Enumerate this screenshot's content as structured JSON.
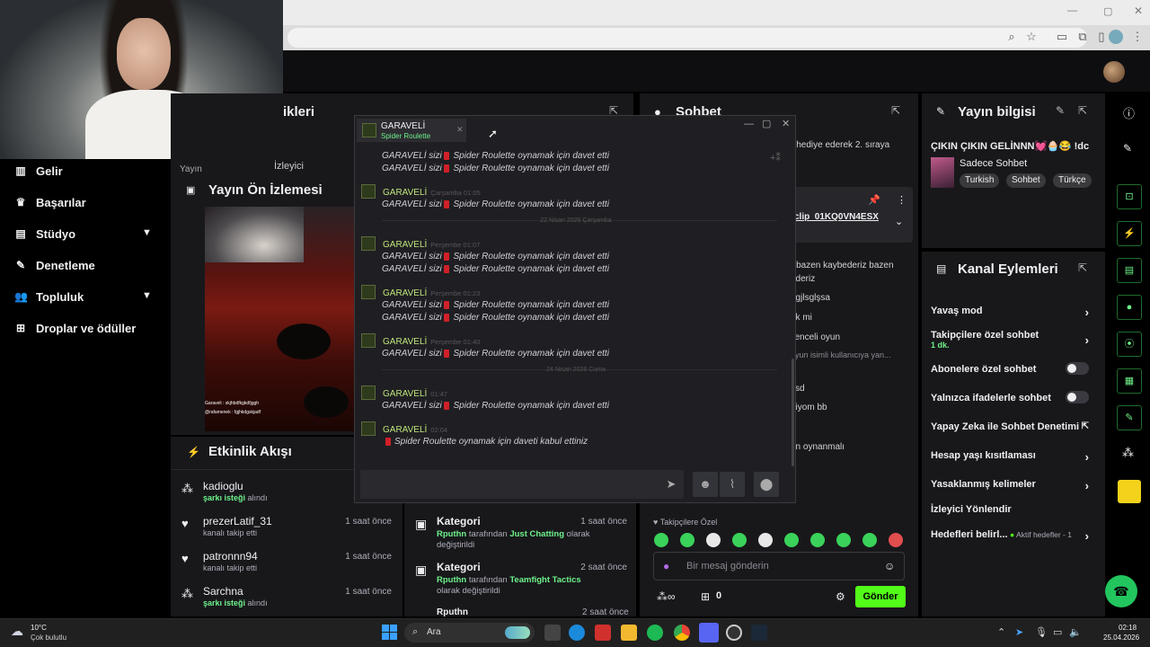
{
  "left_nav": [
    {
      "icon": "bar-chart-icon",
      "label": "Gelir"
    },
    {
      "icon": "trophy-icon",
      "label": "Başarılar"
    },
    {
      "icon": "film-icon",
      "label": "Stüdyo",
      "chevron": true
    },
    {
      "icon": "wrench-icon",
      "label": "Denetleme"
    },
    {
      "icon": "users-icon",
      "label": "Topluluk",
      "chevron": true
    },
    {
      "icon": "gift-icon",
      "label": "Droplar ve ödüller"
    }
  ],
  "stats_panel": {
    "title_fragment": "ikleri",
    "col1": "Yayın",
    "col2": "İzleyici"
  },
  "preview": {
    "title": "Yayın Ön İzlemesi",
    "overlay_chat": [
      "Garaveli : skjhbdfkgkdfjggh",
      "@rafamenek : fgjhkdgskjadf"
    ]
  },
  "events": {
    "title": "Etkinlik Akışı",
    "items": [
      {
        "icon": "points-icon",
        "name": "kadioglu",
        "highlight": "şarkı isteği",
        "suffix": "alındı",
        "time": "1"
      },
      {
        "icon": "heart-icon",
        "name": "prezerLatif_31",
        "sub": "kanalı takip etti",
        "time": "1 saat önce"
      },
      {
        "icon": "heart-icon",
        "name": "patronnn94",
        "sub": "kanalı takip etti",
        "time": "1 saat önce"
      },
      {
        "icon": "points-icon",
        "name": "Sarchna",
        "highlight": "şarkı isteği",
        "suffix": "alındı",
        "time": "1 saat önce"
      }
    ]
  },
  "activity": {
    "items": [
      {
        "title": "Kategori",
        "time": "1 saat önce",
        "user": "Rputhn",
        "mid": "tarafından",
        "category": "Just Chatting",
        "end": "olarak değiştirildi"
      },
      {
        "title": "Kategori",
        "time": "2 saat önce",
        "user": "Rputhn",
        "mid": "tarafından",
        "category": "Teamfight Tactics",
        "end": "olarak değiştirildi"
      }
    ],
    "partial": "Rputhn",
    "partial_time": "2 saat önce"
  },
  "chat": {
    "title": "Sohbet",
    "top_text": "lik hediye ederek 2. sıraya",
    "pinned_link": "clip_01KQ0VN4ESX",
    "lines": [
      "r bazen kaybederiz bazen",
      "ederiz",
      "agjlsglşsa",
      "ek mi",
      "ilenceli oyun",
      "oyun isimli kullanıcıya yan...",
      "şsd",
      "diyom bb",
      "ün oynanmalı"
    ],
    "followers_only": "Takipçilere Özel",
    "input_placeholder": "Bir mesaj gönderin",
    "points": "0",
    "send_label": "Gönder"
  },
  "stream_info": {
    "title": "Yayın bilgisi",
    "stream_title": "ÇIKIN ÇIKIN GELİNNN💓🧁😂 !dc",
    "category": "Sadece Sohbet",
    "tags": [
      "Turkish",
      "Sohbet",
      "Türkçe"
    ]
  },
  "channel_actions": {
    "title": "Kanal Eylemleri",
    "rows": [
      {
        "label": "Yavaş mod",
        "control": "chevron"
      },
      {
        "label": "Takipçilere özel sohbet",
        "sub": "1 dk.",
        "control": "chevron"
      },
      {
        "label": "Abonelere özel sohbet",
        "control": "toggle"
      },
      {
        "label": "Yalnızca ifadelerle sohbet",
        "control": "toggle"
      },
      {
        "label": "Yapay Zeka ile Sohbet Denetimi",
        "control": "external"
      },
      {
        "label": "Hesap yaşı kısıtlaması",
        "control": "chevron"
      },
      {
        "label": "Yasaklanmış kelimeler",
        "control": "chevron"
      },
      {
        "label": "İzleyici Yönlendir",
        "control": "none"
      },
      {
        "label": "Hedefleri belirl...",
        "extra": "Aktif hedefler - 1",
        "control": "chevron"
      }
    ]
  },
  "whisper": {
    "tab_name": "GARAVELİ",
    "tab_sub": "Spider Roulette",
    "invite_text": "GARAVELİ sizi",
    "game_text": "Spider Roulette oynamak için davet etti",
    "accept_text": "Spider Roulette oynamak için daveti kabul ettiniz",
    "sender": "GARAVELİ",
    "blocks": [
      {
        "time": "Çarşamba 01:05",
        "lines": 1
      },
      {
        "divider": "22 Nisan 2026 Çarşamba"
      },
      {
        "time": "Perşembe 01:07",
        "lines": 2
      },
      {
        "time": "Perşembe 01:23",
        "lines": 2
      },
      {
        "time": "Perşembe 01:40",
        "lines": 1
      },
      {
        "divider": "24 Nisan 2026 Cuma"
      },
      {
        "time": "01:47",
        "lines": 1
      },
      {
        "time": "02:04",
        "accept": true
      }
    ]
  },
  "taskbar": {
    "weather_temp": "10°C",
    "weather_desc": "Çok bulutlu",
    "search": "Ara",
    "time": "02:18",
    "date": "25.04.2026"
  },
  "colors": {
    "accent_green": "#6ef28a",
    "brand_green": "#53fc18",
    "panel": "#18181b"
  }
}
